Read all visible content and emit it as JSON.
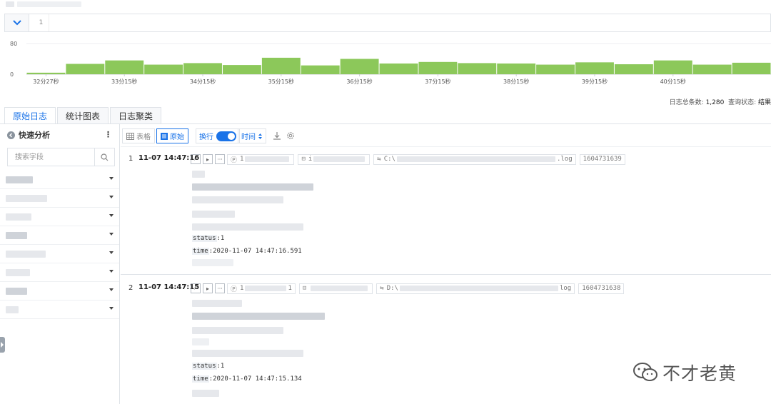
{
  "query": {
    "line_number": "1",
    "toggle_icon": "chevron-down-icon"
  },
  "histogram": {
    "y_ticks": [
      "80",
      "0"
    ],
    "y_max": 80,
    "values": [
      4,
      27,
      36,
      25,
      29,
      24,
      43,
      23,
      40,
      28,
      32,
      29,
      28,
      25,
      31,
      26,
      36,
      25,
      30
    ],
    "x_labels": [
      "32分27秒",
      "33分15秒",
      "34分15秒",
      "35分15秒",
      "36分15秒",
      "37分15秒",
      "38分15秒",
      "39分15秒",
      "40分15秒"
    ],
    "bar_color": "#8cc85a"
  },
  "summary": {
    "total_label": "日志总条数:",
    "total_value": "1,280",
    "status_label": "查询状态:",
    "status_value": "结果"
  },
  "tabs": [
    "原始日志",
    "统计图表",
    "日志聚类"
  ],
  "sidebar": {
    "title": "快速分析",
    "more": "⋮",
    "search_placeholder": "搜索字段"
  },
  "toolbar": {
    "table_label": "表格",
    "raw_label": "原始",
    "wrap_label": "换行",
    "time_label": "时间",
    "accent": "#1a73e8"
  },
  "logs": [
    {
      "index": "1",
      "time": "11-07 14:47:16",
      "ip_prefix": "1",
      "host_prefix": "i",
      "path_prefix": "C:\\",
      "path_suffix": ".log",
      "timestamp": "1604731639",
      "status_key": "status",
      "status_value": ":1",
      "time_key": "time",
      "time_value": ":2020-11-07 14:47:16.591"
    },
    {
      "index": "2",
      "time": "11-07 14:47:15",
      "ip_prefix": "1",
      "ip_suffix": "1",
      "path_prefix": "D:\\",
      "path_suffix": "log",
      "timestamp": "1604731638",
      "status_key": "status",
      "status_value": ":1",
      "time_key": "time",
      "time_value": ":2020-11-07 14:47:15.134"
    }
  ],
  "watermark": {
    "text": "不才老黄"
  }
}
